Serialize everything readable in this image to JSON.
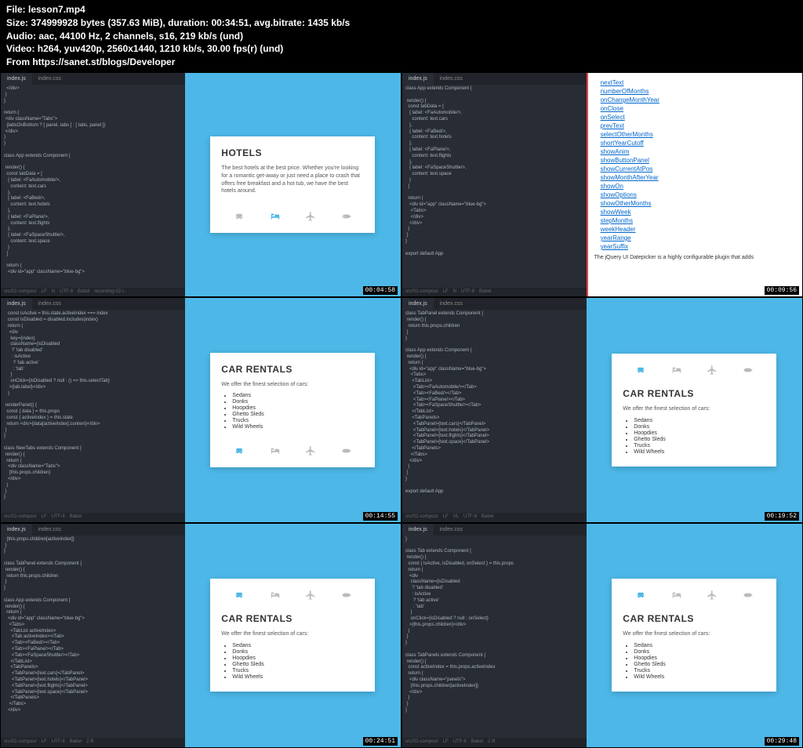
{
  "header": {
    "file": "File: lesson7.mp4",
    "size": "Size: 374999928 bytes (357.63 MiB), duration: 00:34:51, avg.bitrate: 1435 kb/s",
    "audio": "Audio: aac, 44100 Hz, 2 channels, s16, 219 kb/s (und)",
    "video": "Video: h264, yuv420p, 2560x1440, 1210 kb/s, 30.00 fps(r) (und)",
    "from": "From https://sanet.st/blogs/Developer"
  },
  "editor_tabs": {
    "a": "index.js",
    "b": "index.css"
  },
  "status_items": [
    "src/02-compour",
    "LF",
    "N",
    "UTF-8",
    "Babel",
    "recording-02-r..",
    "2 fil"
  ],
  "timestamps": [
    "00:04:58",
    "00:09:56",
    "00:14:55",
    "00:19:52",
    "00:24:51",
    "00:29:48"
  ],
  "hotels": {
    "title": "HOTELS",
    "text": "The best hotels at the best price. Whether you're looking for a romantic get-away or just need a place to crash that offers free breakfast and a hot tub, we have the best hotels around."
  },
  "cars": {
    "title": "CAR RENTALS",
    "text": "We offer the finest selection of cars:",
    "items": [
      "Sedans",
      "Donks",
      "Hoopdies",
      "Ghetto Sleds",
      "Trucks",
      "Wild Wheels"
    ]
  },
  "doc_links": [
    "nextText",
    "numberOfMonths",
    "onChangeMonthYear",
    "onClose",
    "onSelect",
    "prevText",
    "selectOtherMonths",
    "shortYearCutoff",
    "showAnim",
    "showButtonPanel",
    "showCurrentAtPos",
    "showMonthAfterYear",
    "showOn",
    "showOptions",
    "showOtherMonths",
    "showWeek",
    "stepMonths",
    "weekHeader",
    "yearRange",
    "yearSuffix"
  ],
  "doc_text": "The jQuery UI Datepicker is a highly configurable plugin that adds",
  "code1": "  </div>\n )\n}\n\nreturn (\n <div className=\"Tabs\">\n  {tabsOnBottom ? [ panel, tabs ] : [ tabs, panel ]}\n </div>\n)\n}\n\nclass App extends Component {\n\n render() {\n  const tabData = [\n   { label: <FaAutomobile/>,\n     content: text.cars\n   },\n   { label: <FaBed/>,\n     content: text.hotels\n   },\n   { label: <FaPlane/>,\n     content: text.flights\n   },\n   { label: <FaSpaceShuttle/>,\n     content: text.space\n   }\n  ]\n\n  return (\n   <div id=\"app\" className=\"blue-bg\">",
  "code2": "class App extends Component {\n\n render() {\n  const tabData = [\n   { label: <FaAutomobile/>,\n     content: text.cars\n   },\n   { label: <FaBed/>,\n     content: text.hotels\n   },\n   { label: <FaPlane/>,\n     content: text.flights\n   },\n   { label: <FaSpaceShuttle/>,\n     content: text.space\n   }\n  ]\n\n  return (\n   <div id=\"app\" className=\"blue-bg\">\n    <Tabs>\n    </div>\n   </div>\n  )\n }\n}\n\nexport default App",
  "code3": "   const isActive = this.state.activeIndex === index\n   const isDisabled = disabled.includes(index)\n   return (\n    <div\n     key={index}\n     className={isDisabled\n      ? 'tab disabled'\n      : isActive\n       ? 'tab active'\n       : 'tab'\n     }\n     onClick={isDisabled ? null : () => this.selectTab}\n    >{tab.label}</div>\n   )\n\n renderPanel() {\n  const { data } = this.props\n  const { activeIndex } = this.state\n  return <div>{data[activeIndex].content}</div>\n }\n}\n\nclass NewTabs extends Component {\n render() {\n  return (\n   <div className=\"Tabs\">\n    {this.props.children}\n   </div>\n  )\n }\n}",
  "code4": "class TabPanel extends Component {\n render() {\n  return this.props.children\n }\n}\n\nclass App extends Component {\n render() {\n  return (\n   <div id=\"app\" className=\"blue-bg\">\n    <Tabs>\n     <TabList>\n      <Tab><FaAutomobile/></Tab>\n      <Tab><FaBed/></Tab>\n      <Tab><FaPlane/></Tab>\n      <Tab><FaSpaceShuttle/></Tab>\n     </TabList>\n     <TabPanels>\n      <TabPanel>{text.cars}</TabPanel>\n      <TabPanel>{text.hotels}</TabPanel>\n      <TabPanel>{text.flights}</TabPanel>\n      <TabPanel>{text.space}</TabPanel>\n     </TabPanels>\n    </Tabs>\n   </div>\n  )\n }\n}\n\nexport default App",
  "code5": "  {this.props.children[activeIndex]}\n }\n}\n\nclass TabPanel extends Component {\n render() {\n  return this.props.children\n }\n}\n\nclass App extends Component {\n render() {\n  return (\n   <div id=\"app\" className=\"blue-bg\">\n    <Tabs>\n     <TabList activeIndex>\n      <Tab activeIndex></Tab>\n      <Tab><FaBed/></Tab>\n      <Tab><FaPlane/></Tab>\n      <Tab><FaSpaceShuttle/></Tab>\n     </TabList>\n     <TabPanels>\n      <TabPanel>{text.cars}</TabPanel>\n      <TabPanel>{text.hotels}</TabPanel>\n      <TabPanel>{text.flights}</TabPanel>\n      <TabPanel>{text.space}</TabPanel>\n     </TabPanels>\n    </Tabs>\n   </div>",
  "code6": "}\n\nclass Tab extends Component {\n render() {\n  const { isActive, isDisabled, onSelect } = this.props\n  return (\n   <div\n    className={isDisabled\n     ? 'tab disabled'\n     : isActive\n      ? 'tab active'\n      : 'tab'\n    }\n    onClick={isDisabled ? null : onSelect}\n   >{this.props.children}</div>\n  )\n }\n}\n\nclass TabPanels extends Component {\n render() {\n  const activeIndex = this.props.activeIndex\n  return (\n   <div className=\"panels\">\n    {this.props.children[activeIndex]}\n   </div>\n  )\n }\n}"
}
